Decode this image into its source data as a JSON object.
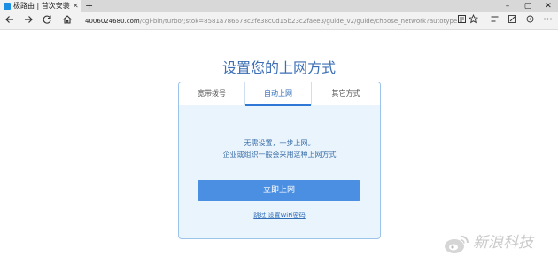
{
  "browser": {
    "tab_title": "极路由 | 首次安装",
    "tab_close": "✕",
    "new_tab": "+",
    "window_controls": [
      "–",
      "▢",
      "✕"
    ],
    "url_host": "4006024680.com",
    "url_path": "/cgi-bin/turbo/;stok=8581a786678c2fe38c0d15b23c2faee3/guide_v2/guide/choose_network?autotype=pppoe",
    "nav_icons": [
      "back-icon",
      "forward-icon",
      "refresh-icon",
      "home-icon"
    ],
    "toolbar_icons": [
      "reading-view-icon",
      "favorite-star-icon",
      "hub-icon",
      "web-note-icon",
      "share-icon",
      "more-icon"
    ]
  },
  "page": {
    "title": "设置您的上网方式",
    "tabs": [
      {
        "label": "宽带拨号",
        "active": false
      },
      {
        "label": "自动上网",
        "active": true
      },
      {
        "label": "其它方式",
        "active": false
      }
    ],
    "description_line1": "无需设置，一步上网。",
    "description_line2": "企业或组织一般会采用这种上网方式",
    "connect_button": "立即上网",
    "skip_link": "跳过,设置WiFi密码"
  },
  "watermark": {
    "logo": "sina-logo",
    "text": "新浪科技"
  },
  "colors": {
    "accent": "#4b8fe2",
    "title": "#3c6fb4",
    "card_bg": "#eaf4fc",
    "card_border": "#9cc4ea"
  }
}
